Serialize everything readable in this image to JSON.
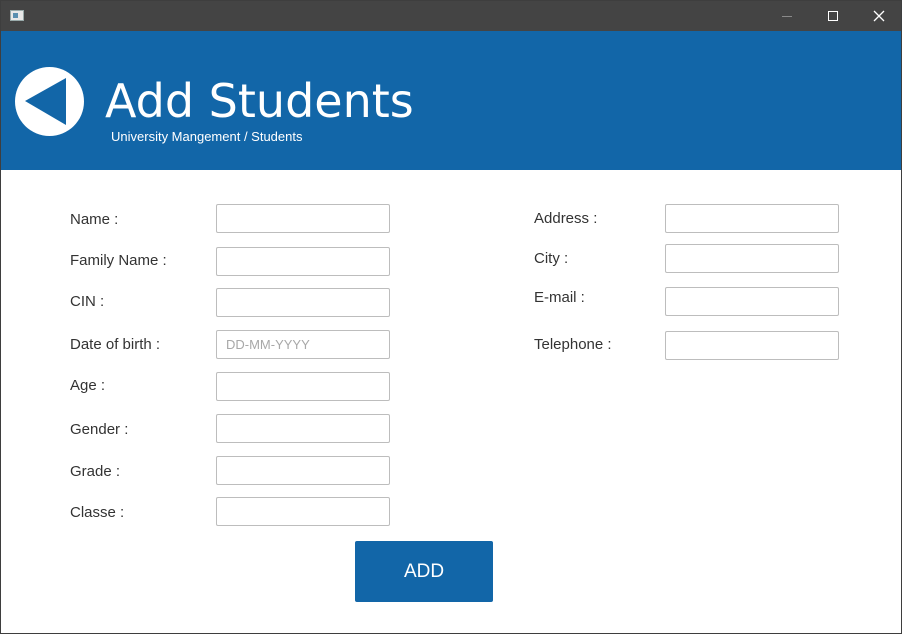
{
  "window": {
    "title": "",
    "controls": {
      "minimize_icon": "minimize-icon",
      "maximize_icon": "maximize-icon",
      "close_icon": "close-icon"
    }
  },
  "header": {
    "title": "Add Students",
    "breadcrumb": "University Mangement / Students",
    "back_icon": "back-arrow-icon",
    "background_color": "#1266a8"
  },
  "form": {
    "left": [
      {
        "label": "Name :",
        "value": "",
        "placeholder": ""
      },
      {
        "label": "Family Name :",
        "value": "",
        "placeholder": ""
      },
      {
        "label": "CIN :",
        "value": "",
        "placeholder": ""
      },
      {
        "label": "Date of birth :",
        "value": "",
        "placeholder": "DD-MM-YYYY"
      },
      {
        "label": "Age :",
        "value": "",
        "placeholder": ""
      },
      {
        "label": "Gender :",
        "value": "",
        "placeholder": ""
      },
      {
        "label": "Grade :",
        "value": "",
        "placeholder": ""
      },
      {
        "label": "Classe :",
        "value": "",
        "placeholder": ""
      }
    ],
    "right": [
      {
        "label": "Address :",
        "value": "",
        "placeholder": ""
      },
      {
        "label": "City :",
        "value": "",
        "placeholder": ""
      },
      {
        "label": "E-mail :",
        "value": "",
        "placeholder": ""
      },
      {
        "label": "Telephone :",
        "value": "",
        "placeholder": ""
      }
    ],
    "submit_label": "ADD",
    "accent_color": "#1266a8"
  }
}
